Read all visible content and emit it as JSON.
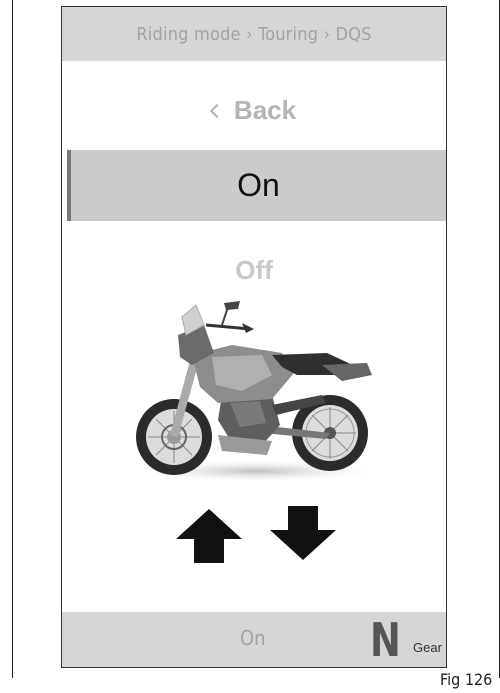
{
  "header": {
    "breadcrumb": "Riding mode › Touring › DQS"
  },
  "menu": {
    "back_label": "Back",
    "options": [
      {
        "label": "On",
        "selected": true
      },
      {
        "label": "Off",
        "selected": false
      }
    ]
  },
  "navigation": {
    "up_icon": "arrow-up-icon",
    "down_icon": "arrow-down-icon"
  },
  "status_bar": {
    "value": "On",
    "gear": "N",
    "gear_label": "Gear"
  },
  "figure": {
    "label": "Fig 126"
  },
  "colors": {
    "bar_bg": "#d6d6d6",
    "selected_bg": "#cbcbcb",
    "dim_text": "#b4b4b4"
  }
}
